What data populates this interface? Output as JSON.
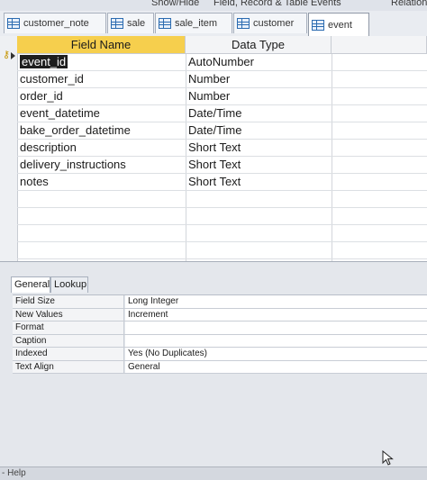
{
  "ribbon": {
    "group1": "Show/Hide",
    "group2": "Field, Record & Table Events",
    "group3": "Relation"
  },
  "tabs": [
    {
      "label": "customer_note",
      "active": false,
      "icon": "table-icon"
    },
    {
      "label": "sale",
      "active": false,
      "icon": "table-icon"
    },
    {
      "label": "sale_item",
      "active": false,
      "icon": "table-icon"
    },
    {
      "label": "customer",
      "active": false,
      "icon": "table-icon"
    },
    {
      "label": "event",
      "active": true,
      "icon": "table-icon"
    }
  ],
  "grid": {
    "header": {
      "field_name": "Field Name",
      "data_type": "Data Type"
    },
    "fields": [
      {
        "name": "event_id",
        "type": "AutoNumber",
        "primary_key": true,
        "selected": true
      },
      {
        "name": "customer_id",
        "type": "Number"
      },
      {
        "name": "order_id",
        "type": "Number"
      },
      {
        "name": "event_datetime",
        "type": "Date/Time"
      },
      {
        "name": "bake_order_datetime",
        "type": "Date/Time"
      },
      {
        "name": "description",
        "type": "Short Text"
      },
      {
        "name": "delivery_instructions",
        "type": "Short Text"
      },
      {
        "name": "notes",
        "type": "Short Text"
      }
    ]
  },
  "properties": {
    "tabs": {
      "general": "General",
      "lookup": "Lookup"
    },
    "rows": [
      {
        "label": "Field Size",
        "value": "Long Integer"
      },
      {
        "label": "New Values",
        "value": "Increment"
      },
      {
        "label": "Format",
        "value": ""
      },
      {
        "label": "Caption",
        "value": ""
      },
      {
        "label": "Indexed",
        "value": "Yes (No Duplicates)"
      },
      {
        "label": "Text Align",
        "value": "General"
      }
    ]
  },
  "statusbar": {
    "text": "- Help"
  },
  "colors": {
    "header_accent": "#f6cf4d",
    "selection": "#1e1e1e",
    "tab_icon": "#2b6bb0",
    "key_icon": "#c69500"
  }
}
